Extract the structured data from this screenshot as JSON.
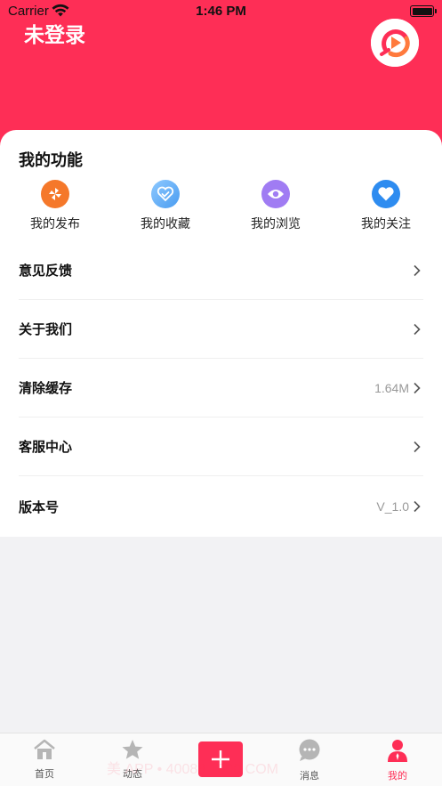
{
  "status_bar": {
    "carrier": "Carrier",
    "time": "1:46 PM"
  },
  "header": {
    "title": "未登录",
    "accent_color": "#fe2e56"
  },
  "functions": {
    "title": "我的功能",
    "items": [
      {
        "label": "我的发布",
        "icon": "publish-icon",
        "color": "#f5782a"
      },
      {
        "label": "我的收藏",
        "icon": "favorite-icon",
        "color": "#5aa8f0"
      },
      {
        "label": "我的浏览",
        "icon": "eye-icon",
        "color": "#a07cf3"
      },
      {
        "label": "我的关注",
        "icon": "heart-icon",
        "color": "#2e8cf0"
      }
    ]
  },
  "menu": [
    {
      "label": "意见反馈",
      "value": ""
    },
    {
      "label": "关于我们",
      "value": ""
    },
    {
      "label": "清除缓存",
      "value": "1.64M"
    },
    {
      "label": "客服中心",
      "value": ""
    },
    {
      "label": "版本号",
      "value": "V_1.0"
    }
  ],
  "tabbar": {
    "items": [
      {
        "label": "首页",
        "icon": "home-icon"
      },
      {
        "label": "动态",
        "icon": "star-icon"
      },
      {
        "label": "",
        "icon": "add-icon"
      },
      {
        "label": "消息",
        "icon": "message-icon"
      },
      {
        "label": "我的",
        "icon": "profile-icon",
        "active": true
      }
    ]
  },
  "watermark": "美 APP • 40088 1800 COM"
}
